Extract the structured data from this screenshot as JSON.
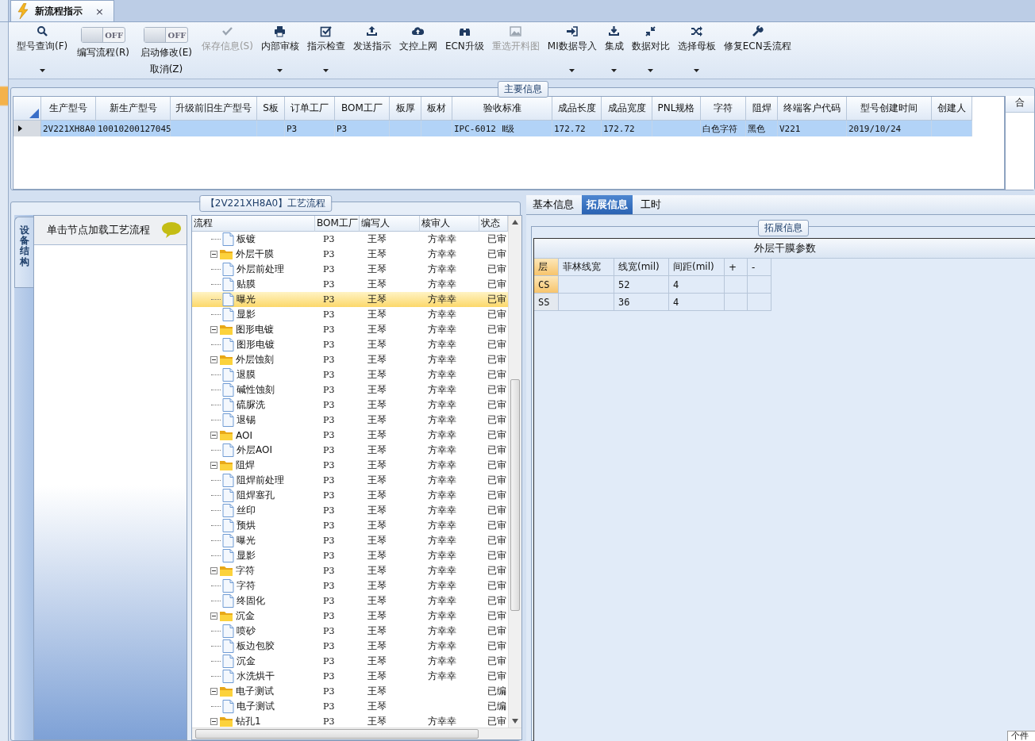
{
  "window_tab": {
    "title": "新流程指示",
    "close": "×"
  },
  "toolbar": [
    {
      "kind": "button",
      "label": "型号查询(F)",
      "disabled": false,
      "dropdown": true
    },
    {
      "kind": "toggle",
      "label": "编写流程(R)",
      "state_text": "OFF",
      "on": false
    },
    {
      "kind": "toggle",
      "label": "启动修改(E)",
      "sub_label": "取消(Z)",
      "state_text": "OFF",
      "on": false
    },
    {
      "kind": "button",
      "label": "保存信息(S)",
      "disabled": true,
      "dropdown": false
    },
    {
      "kind": "button",
      "label": "内部审核",
      "disabled": false,
      "dropdown": true
    },
    {
      "kind": "button",
      "label": "指示检查",
      "disabled": false,
      "dropdown": true
    },
    {
      "kind": "button",
      "label": "发送指示",
      "disabled": false,
      "dropdown": false
    },
    {
      "kind": "button",
      "label": "文控上网",
      "disabled": false,
      "dropdown": false
    },
    {
      "kind": "button",
      "label": "ECN升级",
      "disabled": false,
      "dropdown": false
    },
    {
      "kind": "button",
      "label": "重选开料图",
      "disabled": true,
      "dropdown": false
    },
    {
      "kind": "button",
      "label": "MI数据导入",
      "disabled": false,
      "dropdown": true
    },
    {
      "kind": "button",
      "label": "集成",
      "disabled": false,
      "dropdown": true
    },
    {
      "kind": "button",
      "label": "数据对比",
      "disabled": false,
      "dropdown": true
    },
    {
      "kind": "button",
      "label": "选择母板",
      "disabled": false,
      "dropdown": true
    },
    {
      "kind": "button",
      "label": "修复ECN丢流程",
      "disabled": false,
      "dropdown": false
    }
  ],
  "main_info": {
    "title": "主要信息",
    "columns": [
      "生产型号",
      "新生产型号",
      "升级前旧生产型号",
      "S板",
      "订单工厂",
      "BOM工厂",
      "板厚",
      "板材",
      "验收标准",
      "成品长度",
      "成品宽度",
      "PNL规格",
      "字符",
      "阻焊",
      "终端客户代码",
      "型号创建时间",
      "创建人"
    ],
    "rows": [
      {
        "selected": true,
        "cells": [
          "2V221XH8A0",
          "10010200127045",
          null,
          null,
          "P3",
          "P3",
          null,
          null,
          "IPC-6012 Ⅱ级",
          "172.72",
          "172.72",
          null,
          "白色字符",
          "黑色",
          "V221",
          "2019/10/24",
          null
        ]
      }
    ],
    "side_panel_header": "合"
  },
  "process_panel": {
    "title": "【2V221XH8A0】工艺流程",
    "side_tab": "设备结构",
    "hint": "单击节点加载工艺流程",
    "columns": [
      "流程",
      "BOM工厂",
      "编写人",
      "核审人",
      "状态"
    ],
    "tree": [
      {
        "children": [
          {
            "name": "板镀",
            "bom": "P3",
            "writer": "王琴",
            "reviewer": "方幸幸",
            "status": "已审",
            "selected": false
          }
        ]
      },
      {
        "name": "外层干膜",
        "bom": "P3",
        "writer": "王琴",
        "reviewer": "方幸幸",
        "status": "已审",
        "selected": false,
        "expanded": true,
        "children": [
          {
            "name": "外层前处理",
            "bom": "P3",
            "writer": "王琴",
            "reviewer": "方幸幸",
            "status": "已审",
            "selected": false
          },
          {
            "name": "贴膜",
            "bom": "P3",
            "writer": "王琴",
            "reviewer": "方幸幸",
            "status": "已审",
            "selected": false
          },
          {
            "name": "曝光",
            "bom": "P3",
            "writer": "王琴",
            "reviewer": "方幸幸",
            "status": "已审",
            "selected": true
          },
          {
            "name": "显影",
            "bom": "P3",
            "writer": "王琴",
            "reviewer": "方幸幸",
            "status": "已审",
            "selected": false
          }
        ]
      },
      {
        "name": "图形电镀",
        "bom": "P3",
        "writer": "王琴",
        "reviewer": "方幸幸",
        "status": "已审",
        "selected": false,
        "expanded": true,
        "children": [
          {
            "name": "图形电镀",
            "bom": "P3",
            "writer": "王琴",
            "reviewer": "方幸幸",
            "status": "已审",
            "selected": false
          }
        ]
      },
      {
        "name": "外层蚀刻",
        "bom": "P3",
        "writer": "王琴",
        "reviewer": "方幸幸",
        "status": "已审",
        "selected": false,
        "expanded": true,
        "children": [
          {
            "name": "退膜",
            "bom": "P3",
            "writer": "王琴",
            "reviewer": "方幸幸",
            "status": "已审",
            "selected": false
          },
          {
            "name": "碱性蚀刻",
            "bom": "P3",
            "writer": "王琴",
            "reviewer": "方幸幸",
            "status": "已审",
            "selected": false
          },
          {
            "name": "硫脲洗",
            "bom": "P3",
            "writer": "王琴",
            "reviewer": "方幸幸",
            "status": "已审",
            "selected": false
          },
          {
            "name": "退锡",
            "bom": "P3",
            "writer": "王琴",
            "reviewer": "方幸幸",
            "status": "已审",
            "selected": false
          }
        ]
      },
      {
        "name": "AOI",
        "bom": "P3",
        "writer": "王琴",
        "reviewer": "方幸幸",
        "status": "已审",
        "selected": false,
        "expanded": true,
        "children": [
          {
            "name": "外层AOI",
            "bom": "P3",
            "writer": "王琴",
            "reviewer": "方幸幸",
            "status": "已审",
            "selected": false
          }
        ]
      },
      {
        "name": "阻焊",
        "bom": "P3",
        "writer": "王琴",
        "reviewer": "方幸幸",
        "status": "已审",
        "selected": false,
        "expanded": true,
        "children": [
          {
            "name": "阻焊前处理",
            "bom": "P3",
            "writer": "王琴",
            "reviewer": "方幸幸",
            "status": "已审",
            "selected": false
          },
          {
            "name": "阻焊塞孔",
            "bom": "P3",
            "writer": "王琴",
            "reviewer": "方幸幸",
            "status": "已审",
            "selected": false
          },
          {
            "name": "丝印",
            "bom": "P3",
            "writer": "王琴",
            "reviewer": "方幸幸",
            "status": "已审",
            "selected": false
          },
          {
            "name": "预烘",
            "bom": "P3",
            "writer": "王琴",
            "reviewer": "方幸幸",
            "status": "已审",
            "selected": false
          },
          {
            "name": "曝光",
            "bom": "P3",
            "writer": "王琴",
            "reviewer": "方幸幸",
            "status": "已审",
            "selected": false
          },
          {
            "name": "显影",
            "bom": "P3",
            "writer": "王琴",
            "reviewer": "方幸幸",
            "status": "已审",
            "selected": false
          }
        ]
      },
      {
        "name": "字符",
        "bom": "P3",
        "writer": "王琴",
        "reviewer": "方幸幸",
        "status": "已审",
        "selected": false,
        "expanded": true,
        "children": [
          {
            "name": "字符",
            "bom": "P3",
            "writer": "王琴",
            "reviewer": "方幸幸",
            "status": "已审",
            "selected": false
          },
          {
            "name": "终固化",
            "bom": "P3",
            "writer": "王琴",
            "reviewer": "方幸幸",
            "status": "已审",
            "selected": false
          }
        ]
      },
      {
        "name": "沉金",
        "bom": "P3",
        "writer": "王琴",
        "reviewer": "方幸幸",
        "status": "已审",
        "selected": false,
        "expanded": true,
        "children": [
          {
            "name": "喷砂",
            "bom": "P3",
            "writer": "王琴",
            "reviewer": "方幸幸",
            "status": "已审",
            "selected": false
          },
          {
            "name": "板边包胶",
            "bom": "P3",
            "writer": "王琴",
            "reviewer": "方幸幸",
            "status": "已审",
            "selected": false
          },
          {
            "name": "沉金",
            "bom": "P3",
            "writer": "王琴",
            "reviewer": "方幸幸",
            "status": "已审",
            "selected": false
          },
          {
            "name": "水洗烘干",
            "bom": "P3",
            "writer": "王琴",
            "reviewer": "方幸幸",
            "status": "已审",
            "selected": false
          }
        ]
      },
      {
        "name": "电子测试",
        "bom": "P3",
        "writer": "王琴",
        "status": "已编",
        "selected": false,
        "expanded": true,
        "children": [
          {
            "name": "电子测试",
            "bom": "P3",
            "writer": "王琴",
            "status": "已编",
            "selected": false
          }
        ]
      },
      {
        "name": "钻孔1",
        "bom": "P3",
        "writer": "王琴",
        "reviewer": "方幸幸",
        "status": "已审",
        "selected": false,
        "expanded": true
      }
    ]
  },
  "detail_panel": {
    "tabs": [
      {
        "label": "基本信息",
        "selected": false
      },
      {
        "label": "拓展信息",
        "selected": true
      },
      {
        "label": "工时",
        "selected": false
      }
    ],
    "group_title": "拓展信息",
    "grid_title": "外层干膜参数",
    "columns": [
      "层",
      "菲林线宽",
      "线宽(mil)",
      "间距(mil)",
      "+",
      "-"
    ],
    "rows": [
      {
        "selected": true,
        "cells": [
          "CS",
          null,
          "52",
          "4",
          null,
          null
        ]
      },
      {
        "selected": false,
        "cells": [
          "SS",
          null,
          "36",
          "4",
          null,
          null
        ]
      }
    ]
  },
  "corner_text": "个件"
}
